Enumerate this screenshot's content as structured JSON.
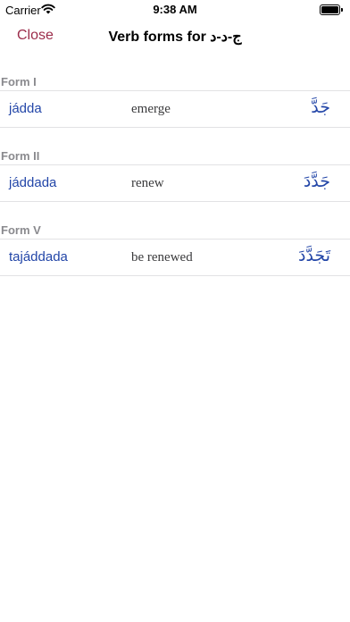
{
  "status_bar": {
    "carrier": "Carrier",
    "time": "9:38 AM"
  },
  "nav": {
    "close_label": "Close",
    "title": "Verb forms for ج-د-د"
  },
  "forms": [
    {
      "header": "Form I",
      "transliteration": "jádda",
      "meaning": "emerge",
      "arabic": "جَدَّ"
    },
    {
      "header": "Form II",
      "transliteration": "jáddada",
      "meaning": "renew",
      "arabic": "جَدَّدَ"
    },
    {
      "header": "Form V",
      "transliteration": "tajáddada",
      "meaning": "be renewed",
      "arabic": "تَجَدَّدَ"
    }
  ],
  "colors": {
    "accent": "#9b2c4a",
    "link": "#2346a8",
    "section_header": "#8a8a8e"
  }
}
